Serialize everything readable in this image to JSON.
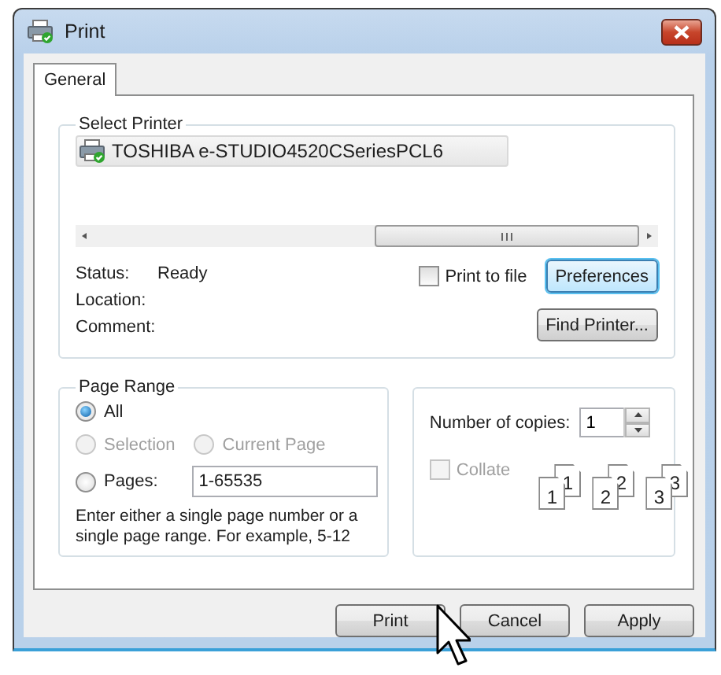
{
  "window": {
    "title": "Print"
  },
  "tabs": [
    {
      "label": "General",
      "selected": true
    }
  ],
  "select_printer": {
    "title": "Select Printer",
    "printers": [
      {
        "name": "TOSHIBA e-STUDIO4520CSeriesPCL6",
        "selected": true
      }
    ],
    "info": [
      {
        "label": "Status:",
        "value": "Ready"
      },
      {
        "label": "Location:"
      },
      {
        "label": "Comment:"
      }
    ],
    "print_to_file": {
      "label": "Print to file",
      "checked": false
    },
    "buttons": [
      {
        "label": "Preferences",
        "focused": true
      },
      {
        "label": "Find Printer...",
        "focused": false
      }
    ]
  },
  "page_range": {
    "title": "Page Range",
    "options": [
      {
        "label": "All",
        "selected": true,
        "disabled": false
      },
      {
        "label": "Selection",
        "selected": false,
        "disabled": true
      },
      {
        "label": "Current Page",
        "selected": false,
        "disabled": true
      },
      {
        "label": "Pages:",
        "selected": false,
        "disabled": false
      }
    ],
    "pages_value": "1-65535",
    "hint": "Enter either a single page number or a single page range.  For example, 5-12"
  },
  "copies": {
    "label": "Number of copies:",
    "value": "1",
    "collate": {
      "label": "Collate",
      "checked": false,
      "disabled": true
    },
    "collate_pages": [
      {
        "back": "1",
        "front": "1"
      },
      {
        "back": "2",
        "front": "2"
      },
      {
        "back": "3",
        "front": "3"
      }
    ]
  },
  "buttons": [
    {
      "label": "Print"
    },
    {
      "label": "Cancel"
    },
    {
      "label": "Apply"
    }
  ]
}
